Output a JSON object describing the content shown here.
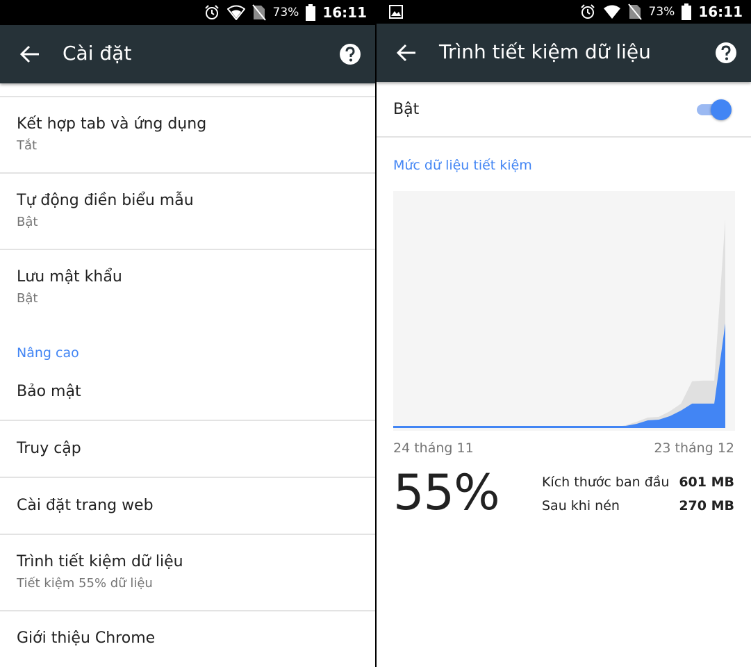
{
  "status_bar": {
    "left": {
      "battery": "73%",
      "time": "16:11",
      "icons": [
        "alarm-icon",
        "wifi-icon",
        "no-sim-icon",
        "battery-icon"
      ]
    },
    "right": {
      "battery": "73%",
      "time": "16:11",
      "icons": [
        "image-notification-icon",
        "alarm-icon",
        "wifi-icon",
        "no-sim-icon",
        "battery-icon"
      ]
    }
  },
  "settings": {
    "title": "Cài đặt",
    "items": [
      {
        "title": "Kết hợp tab và ứng dụng",
        "subtitle": "Tắt"
      },
      {
        "title": "Tự động điền biểu mẫu",
        "subtitle": "Bật"
      },
      {
        "title": "Lưu mật khẩu",
        "subtitle": "Bật"
      }
    ],
    "section_advanced": "Nâng cao",
    "advanced_items": [
      {
        "title": "Bảo mật"
      },
      {
        "title": "Truy cập"
      },
      {
        "title": "Cài đặt trang web"
      },
      {
        "title": "Trình tiết kiệm dữ liệu",
        "subtitle": "Tiết kiệm 55% dữ liệu"
      },
      {
        "title": "Giới thiệu Chrome"
      }
    ]
  },
  "data_saver": {
    "title": "Trình tiết kiệm dữ liệu",
    "toggle_label": "Bật",
    "toggle_on": true,
    "section": "Mức dữ liệu tiết kiệm",
    "date_start": "24 tháng 11",
    "date_end": "23 tháng 12",
    "percent": "55%",
    "original_label": "Kích thước ban đầu",
    "original_value": "601 MB",
    "compressed_label": "Sau khi nén",
    "compressed_value": "270 MB"
  },
  "colors": {
    "accent": "#4285f4",
    "toolbar": "#263238",
    "chart_bg": "#f5f5f5",
    "chart_original": "#e0e0e0"
  },
  "chart_data": {
    "type": "area",
    "x_range": [
      "24 tháng 11",
      "23 tháng 12"
    ],
    "series": [
      {
        "values": [
          0,
          0,
          0,
          0,
          0,
          0,
          0,
          0,
          0,
          0,
          0,
          0,
          0,
          0,
          0,
          0,
          0,
          0,
          0,
          0,
          0,
          0.3,
          0.8,
          1.4,
          1.5,
          2.3,
          3.4,
          6.6,
          6.7,
          6.7,
          29.9
        ]
      },
      {
        "values": [
          0,
          0,
          0,
          0,
          0,
          0,
          0,
          0,
          0,
          0,
          0,
          0,
          0,
          0,
          0,
          0,
          0,
          0,
          0,
          0,
          0,
          0.2,
          0.5,
          1.0,
          1.1,
          1.6,
          2.4,
          3.4,
          3.4,
          3.4,
          14.9
        ]
      }
    ]
  }
}
